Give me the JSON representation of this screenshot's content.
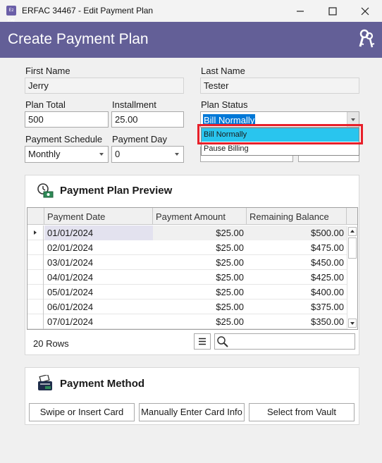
{
  "window": {
    "title": "ERFAC 34467 - Edit Payment Plan",
    "app_icon_text": "Ez Pay"
  },
  "header": {
    "title": "Create Payment Plan"
  },
  "form": {
    "first_name_label": "First Name",
    "first_name_value": "Jerry",
    "last_name_label": "Last Name",
    "last_name_value": "Tester",
    "plan_total_label": "Plan Total",
    "plan_total_value": "500",
    "installment_label": "Installment",
    "installment_value": "25.00",
    "plan_status_label": "Plan Status",
    "plan_status_value": "Bill Normally",
    "plan_status_options": [
      "Bill Normally",
      "Pause Billing"
    ],
    "payment_schedule_label": "Payment Schedule",
    "payment_schedule_value": "Monthly",
    "payment_day_label": "Payment Day",
    "payment_day_value": "0"
  },
  "preview": {
    "title": "Payment Plan Preview",
    "columns": [
      "Payment Date",
      "Payment Amount",
      "Remaining Balance"
    ],
    "rows": [
      [
        "01/01/2024",
        "$25.00",
        "$500.00"
      ],
      [
        "02/01/2024",
        "$25.00",
        "$475.00"
      ],
      [
        "03/01/2024",
        "$25.00",
        "$450.00"
      ],
      [
        "04/01/2024",
        "$25.00",
        "$425.00"
      ],
      [
        "05/01/2024",
        "$25.00",
        "$400.00"
      ],
      [
        "06/01/2024",
        "$25.00",
        "$375.00"
      ],
      [
        "07/01/2024",
        "$25.00",
        "$350.00"
      ]
    ],
    "row_count": "20 Rows"
  },
  "payment_method": {
    "title": "Payment Method",
    "swipe_label": "Swipe or Insert Card",
    "manual_label": "Manually Enter Card Info",
    "vault_label": "Select from Vault"
  },
  "colors": {
    "header": "#635f97",
    "selection": "#29c5ee",
    "highlight": "#e8202a"
  }
}
